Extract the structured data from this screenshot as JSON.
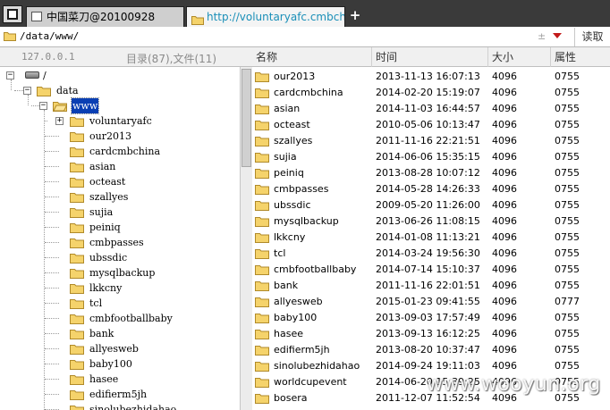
{
  "tabs": [
    {
      "label": "中国菜刀@20100928",
      "active": false
    },
    {
      "label": "http://voluntaryafc.cmbchina....",
      "active": true
    }
  ],
  "new_tab_label": "+",
  "address": {
    "path": "/data/www/",
    "plus_glyph": "±",
    "read_button": "读取"
  },
  "left_header": {
    "host": "127.0.0.1",
    "summary": "目录(87),文件(11)"
  },
  "tree": {
    "root": "/",
    "data": "data",
    "www": "www",
    "children": [
      "voluntaryafc",
      "our2013",
      "cardcmbchina",
      "asian",
      "octeast",
      "szallyes",
      "sujia",
      "peiniq",
      "cmbpasses",
      "ubssdic",
      "mysqlbackup",
      "lkkcny",
      "tcl",
      "cmbfootballbaby",
      "bank",
      "allyesweb",
      "baby100",
      "hasee",
      "edifierm5jh",
      "sinolubezhidahao"
    ]
  },
  "columns": {
    "name": "名称",
    "time": "时间",
    "size": "大小",
    "perm": "属性"
  },
  "files": [
    {
      "name": "our2013",
      "time": "2013-11-13 16:07:13",
      "size": "4096",
      "perm": "0755"
    },
    {
      "name": "cardcmbchina",
      "time": "2014-02-20 15:19:07",
      "size": "4096",
      "perm": "0755"
    },
    {
      "name": "asian",
      "time": "2014-11-03 16:44:57",
      "size": "4096",
      "perm": "0755"
    },
    {
      "name": "octeast",
      "time": "2010-05-06 10:13:47",
      "size": "4096",
      "perm": "0755"
    },
    {
      "name": "szallyes",
      "time": "2011-11-16 22:21:51",
      "size": "4096",
      "perm": "0755"
    },
    {
      "name": "sujia",
      "time": "2014-06-06 15:35:15",
      "size": "4096",
      "perm": "0755"
    },
    {
      "name": "peiniq",
      "time": "2013-08-28 10:07:12",
      "size": "4096",
      "perm": "0755"
    },
    {
      "name": "cmbpasses",
      "time": "2014-05-28 14:26:33",
      "size": "4096",
      "perm": "0755"
    },
    {
      "name": "ubssdic",
      "time": "2009-05-20 11:26:00",
      "size": "4096",
      "perm": "0755"
    },
    {
      "name": "mysqlbackup",
      "time": "2013-06-26 11:08:15",
      "size": "4096",
      "perm": "0755"
    },
    {
      "name": "lkkcny",
      "time": "2014-01-08 11:13:21",
      "size": "4096",
      "perm": "0755"
    },
    {
      "name": "tcl",
      "time": "2014-03-24 19:56:30",
      "size": "4096",
      "perm": "0755"
    },
    {
      "name": "cmbfootballbaby",
      "time": "2014-07-14 15:10:37",
      "size": "4096",
      "perm": "0755"
    },
    {
      "name": "bank",
      "time": "2011-11-16 22:01:51",
      "size": "4096",
      "perm": "0755"
    },
    {
      "name": "allyesweb",
      "time": "2015-01-23 09:41:55",
      "size": "4096",
      "perm": "0777"
    },
    {
      "name": "baby100",
      "time": "2013-09-03 17:57:49",
      "size": "4096",
      "perm": "0755"
    },
    {
      "name": "hasee",
      "time": "2013-09-13 16:12:25",
      "size": "4096",
      "perm": "0755"
    },
    {
      "name": "edifierm5jh",
      "time": "2013-08-20 10:37:47",
      "size": "4096",
      "perm": "0755"
    },
    {
      "name": "sinolubezhidahao",
      "time": "2014-09-24 19:11:03",
      "size": "4096",
      "perm": "0755"
    },
    {
      "name": "worldcupevent",
      "time": "2014-06-20 15:39:25",
      "size": "4096",
      "perm": "0755"
    },
    {
      "name": "bosera",
      "time": "2011-12-07 11:52:54",
      "size": "4096",
      "perm": "0755"
    }
  ],
  "watermark": "www.wooyun.org",
  "icons": {
    "app": "app-window-icon",
    "folder": "folder-icon",
    "drive": "drive-icon",
    "dropdown": "chevron-down-icon"
  },
  "colors": {
    "tabbar_bg": "#3a3a3a",
    "selection": "#0a3fb3",
    "folder_fill": "#f5d36b",
    "active_tab_text": "#1a8fb8"
  }
}
